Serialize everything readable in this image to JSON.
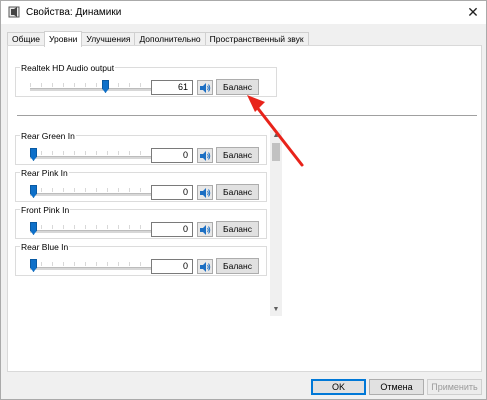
{
  "window": {
    "title": "Свойства: Динамики",
    "close_glyph": "✕"
  },
  "tabs": [
    {
      "label": "Общие",
      "active": false
    },
    {
      "label": "Уровни",
      "active": true
    },
    {
      "label": "Улучшения",
      "active": false
    },
    {
      "label": "Дополнительно",
      "active": false
    },
    {
      "label": "Пространственный звук",
      "active": false
    }
  ],
  "master": {
    "label": "Realtek HD Audio output",
    "value": "61",
    "level": 0.61,
    "balance_label": "Баланс"
  },
  "channels": [
    {
      "label": "Rear Green In",
      "value": "0",
      "level": 0.0,
      "balance_label": "Баланс"
    },
    {
      "label": "Rear Pink In",
      "value": "0",
      "level": 0.0,
      "balance_label": "Баланс"
    },
    {
      "label": "Front Pink In",
      "value": "0",
      "level": 0.0,
      "balance_label": "Баланс"
    },
    {
      "label": "Rear Blue In",
      "value": "0",
      "level": 0.0,
      "balance_label": "Баланс"
    }
  ],
  "footer": {
    "ok_label": "OK",
    "cancel_label": "Отмена",
    "apply_label": "Применить",
    "apply_enabled": false
  },
  "colors": {
    "accent": "#0078d7",
    "slider_thumb": "#0e70c9",
    "annotation_arrow": "#e8231a"
  },
  "icons": {
    "title": "speaker-properties-icon",
    "mute": "speaker-icon"
  }
}
